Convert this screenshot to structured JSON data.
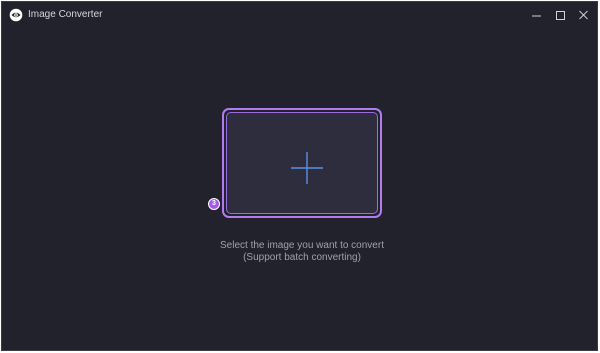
{
  "window": {
    "title": "Image Converter",
    "logo_icon": "eye-logo-icon",
    "controls": {
      "minimize_icon": "minimize-icon",
      "maximize_icon": "maximize-icon",
      "close_icon": "close-icon"
    }
  },
  "main": {
    "drop_zone": {
      "icon": "plus-icon",
      "step_number": "3"
    },
    "hint_line1": "Select the image you want to convert",
    "hint_line2": "(Support batch converting)"
  },
  "colors": {
    "background": "#22222d",
    "drop_zone_border": "#b27cf0",
    "drop_zone_fill": "#2d2d3e",
    "plus_icon": "#5b8ee8",
    "badge": "#a55bf0",
    "hint_text": "#a0a0ad"
  }
}
